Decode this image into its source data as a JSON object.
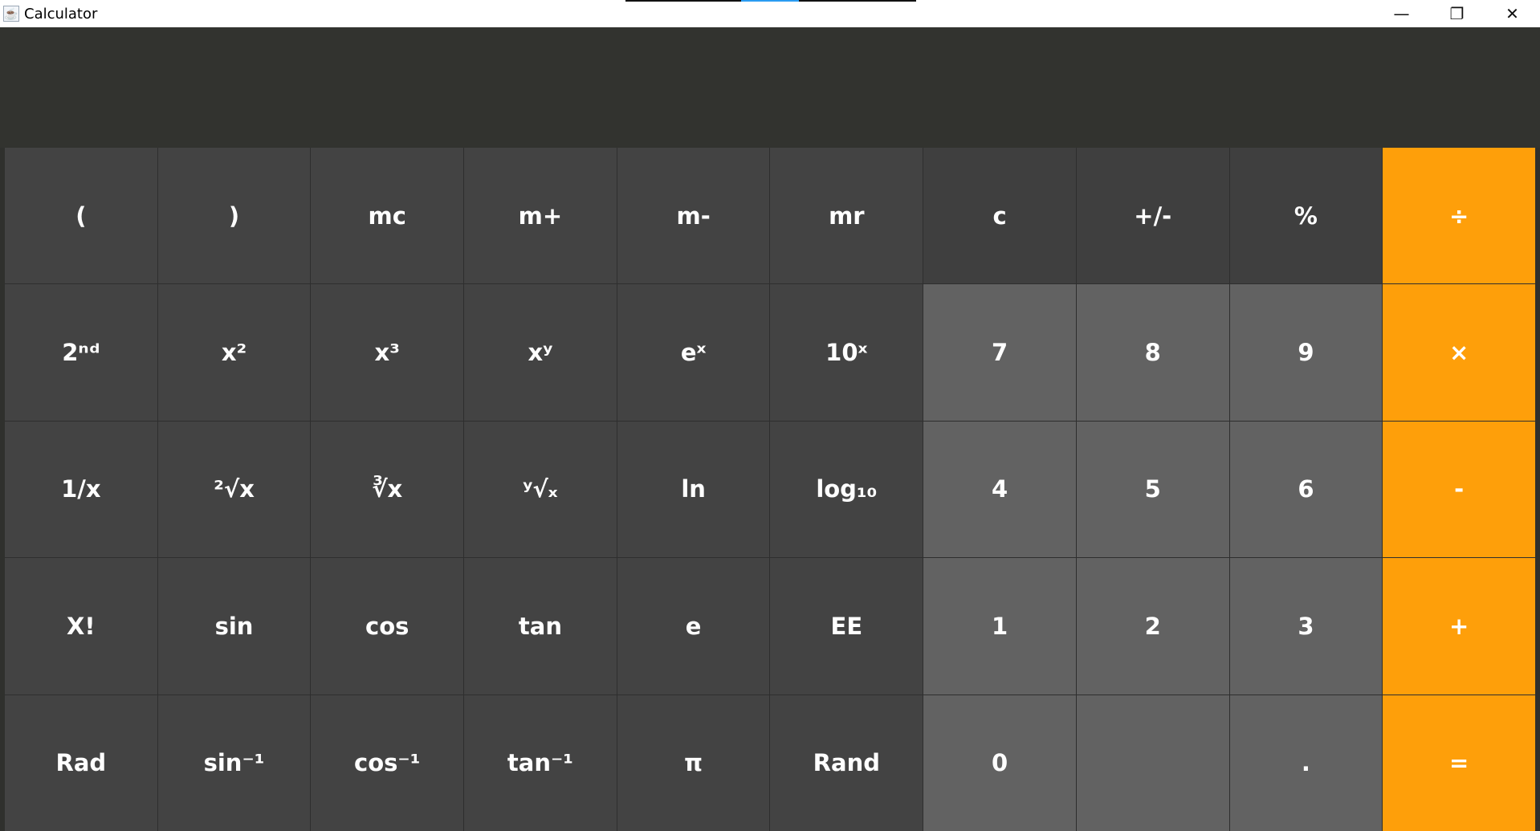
{
  "window": {
    "title": "Calculator",
    "icon": "java-cup-icon",
    "controls": {
      "minimize": "—",
      "restore": "❐",
      "close": "✕"
    }
  },
  "display": {
    "value": ""
  },
  "colors": {
    "operator": "#fe9f0a",
    "function_key": "#434343",
    "digit_key": "#626262",
    "display_bg": "#32332f"
  },
  "keys": {
    "row1": [
      "(",
      ")",
      "mc",
      "m+",
      "m-",
      "mr",
      "c",
      "+/-",
      "%",
      "÷"
    ],
    "row2": [
      "2ⁿᵈ",
      "x²",
      "x³",
      "xʸ",
      "eˣ",
      "10ˣ",
      "7",
      "8",
      "9",
      "×"
    ],
    "row3": [
      "1/x",
      "²√x",
      "∛x",
      "ʸ√ₓ",
      "ln",
      "log₁₀",
      "4",
      "5",
      "6",
      "-"
    ],
    "row4": [
      "X!",
      "sin",
      "cos",
      "tan",
      "e",
      "EE",
      "1",
      "2",
      "3",
      "+"
    ],
    "row5": [
      "Rad",
      "sin⁻¹",
      "cos⁻¹",
      "tan⁻¹",
      "π",
      "Rand",
      "0",
      "",
      ".",
      "="
    ]
  }
}
